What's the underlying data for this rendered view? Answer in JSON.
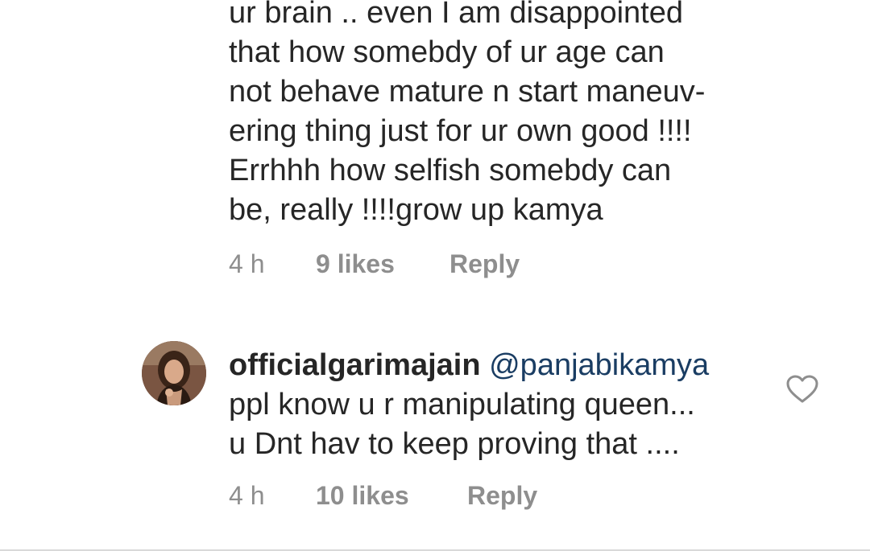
{
  "comments": [
    {
      "lines": [
        "ur brain .. even I am disappointed",
        "that how somebdy of ur age can",
        "not behave mature n start maneuv-",
        "ering thing just for ur own good !!!!",
        "Errhhh how selfish somebdy can",
        "be, really !!!!grow up kamya"
      ],
      "time": "4 h",
      "likes": "9 likes",
      "reply": "Reply"
    },
    {
      "username": "officialgarimajain",
      "mention": "@panjabikamya",
      "lines": [
        "ppl know u r manipulating queen...",
        "u Dnt hav to keep proving that ...."
      ],
      "time": "4 h",
      "likes": "10 likes",
      "reply": "Reply",
      "like_icon": "heart-outline-icon"
    }
  ],
  "colors": {
    "text": "#262626",
    "meta": "#8e8e8e",
    "mention": "#1a3d63"
  }
}
